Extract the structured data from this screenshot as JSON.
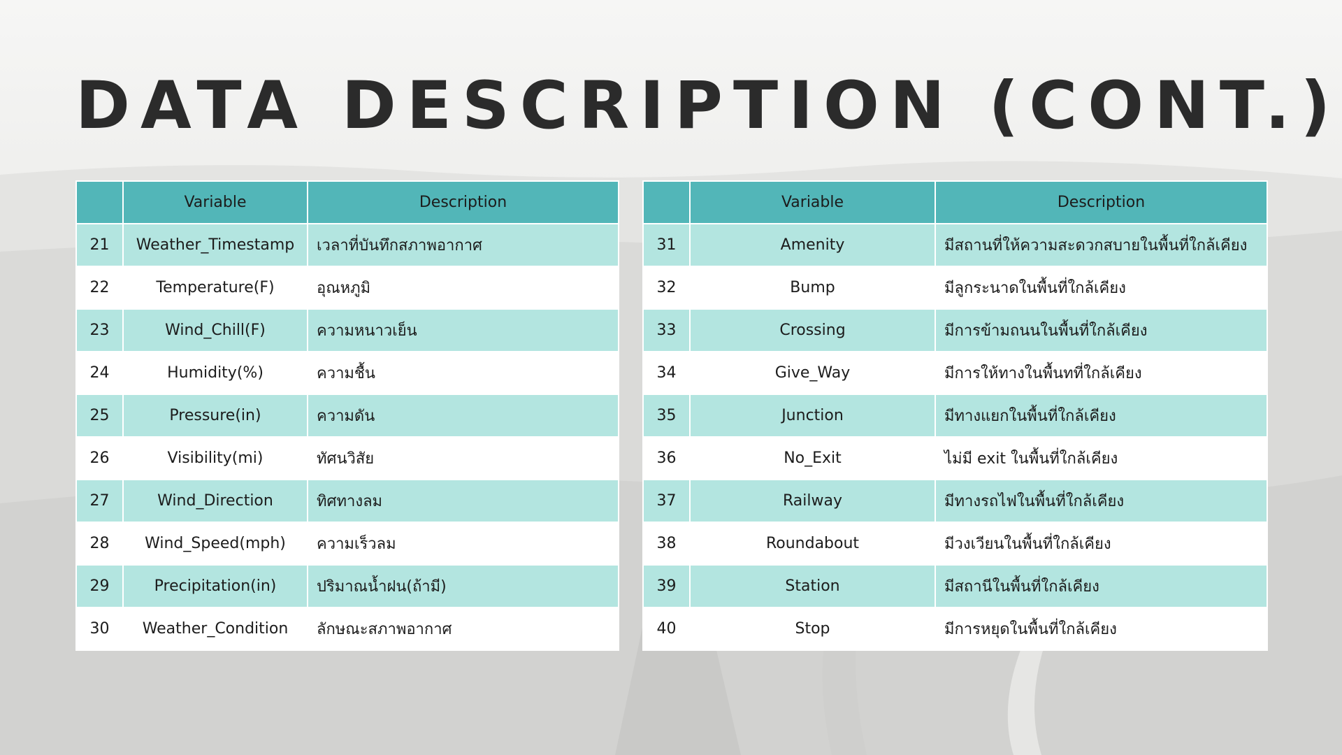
{
  "slide": {
    "title": "DATA DESCRIPTION (CONT.)",
    "colors": {
      "header_bg": "#52b6b8",
      "row_tinted": "#b3e5e0",
      "row_plain": "#ffffff",
      "title_text": "#2b2b2b"
    }
  },
  "tables": [
    {
      "headers": [
        "",
        "Variable",
        "Description"
      ],
      "rows": [
        {
          "no": "21",
          "variable": "Weather_Timestamp",
          "description": "เวลาที่บันทึกสภาพอากาศ"
        },
        {
          "no": "22",
          "variable": "Temperature(F)",
          "description": "อุณหภูมิ"
        },
        {
          "no": "23",
          "variable": "Wind_Chill(F)",
          "description": "ความหนาวเย็น"
        },
        {
          "no": "24",
          "variable": "Humidity(%)",
          "description": "ความชื้น"
        },
        {
          "no": "25",
          "variable": "Pressure(in)",
          "description": "ความดัน"
        },
        {
          "no": "26",
          "variable": "Visibility(mi)",
          "description": "ทัศนวิสัย"
        },
        {
          "no": "27",
          "variable": "Wind_Direction",
          "description": "ทิศทางลม"
        },
        {
          "no": "28",
          "variable": "Wind_Speed(mph)",
          "description": "ความเร็วลม"
        },
        {
          "no": "29",
          "variable": "Precipitation(in)",
          "description": "ปริมาณน้ำฝน(ถ้ามี)"
        },
        {
          "no": "30",
          "variable": "Weather_Condition",
          "description": "ลักษณะสภาพอากาศ"
        }
      ]
    },
    {
      "headers": [
        "",
        "Variable",
        "Description"
      ],
      "rows": [
        {
          "no": "31",
          "variable": "Amenity",
          "description": "มีสถานที่ให้ความสะดวกสบายในพื้นที่ใกล้เคียง"
        },
        {
          "no": "32",
          "variable": "Bump",
          "description": "มีลูกระนาดในพื้นที่ใกล้เคียง"
        },
        {
          "no": "33",
          "variable": "Crossing",
          "description": "มีการข้ามถนนในพื้นที่ใกล้เคียง"
        },
        {
          "no": "34",
          "variable": "Give_Way",
          "description": "มีการให้ทางในพื้นทที่ใกล้เคียง"
        },
        {
          "no": "35",
          "variable": "Junction",
          "description": "มีทางแยกในพื้นที่ใกล้เคียง"
        },
        {
          "no": "36",
          "variable": "No_Exit",
          "description": "ไม่มี exit ในพื้นที่ใกล้เคียง"
        },
        {
          "no": "37",
          "variable": "Railway",
          "description": "มีทางรถไฟในพื้นที่ใกล้เคียง"
        },
        {
          "no": "38",
          "variable": "Roundabout",
          "description": "มีวงเวียนในพื้นที่ใกล้เคียง"
        },
        {
          "no": "39",
          "variable": "Station",
          "description": "มีสถานีในพื้นที่ใกล้เคียง"
        },
        {
          "no": "40",
          "variable": "Stop",
          "description": "มีการหยุดในพื้นที่ใกล้เคียง"
        }
      ]
    }
  ]
}
